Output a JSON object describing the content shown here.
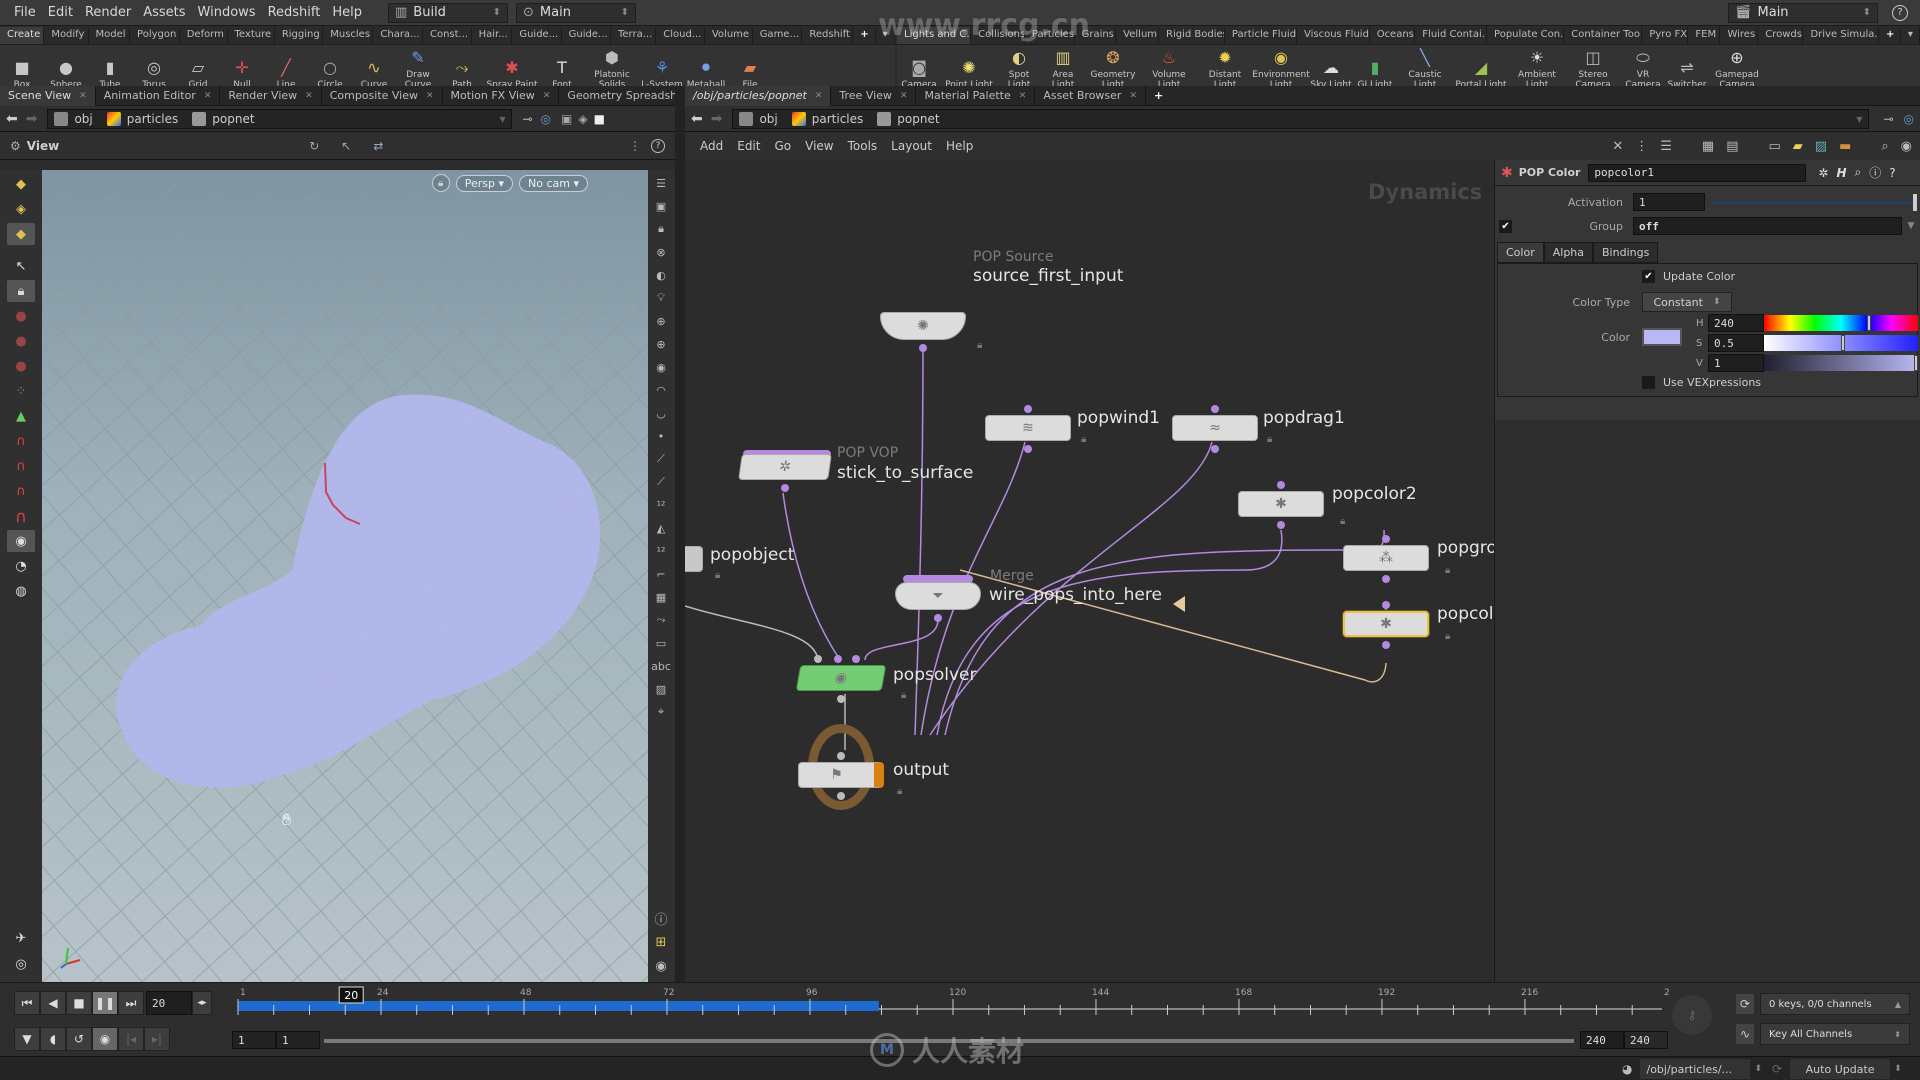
{
  "menubar": {
    "items": [
      "File",
      "Edit",
      "Render",
      "Assets",
      "Windows",
      "Redshift",
      "Help"
    ],
    "desktop": "Build",
    "desktop_icon": "layout-icon",
    "context": "Main",
    "context_icon": "target-icon",
    "right_context": "Main",
    "help_icon": "help-icon"
  },
  "shelf_left": {
    "tabs": [
      "Create",
      "Modify",
      "Model",
      "Polygon",
      "Deform",
      "Texture",
      "Rigging",
      "Muscles",
      "Chara...",
      "Const...",
      "Hair...",
      "Guide...",
      "Guide...",
      "Terra...",
      "Cloud...",
      "Volume",
      "Game...",
      "Redshift"
    ],
    "active_tab": "Create",
    "tools": [
      {
        "label": "Box",
        "icon": "box-icon",
        "glyph": "■",
        "color": "#c8c8c8"
      },
      {
        "label": "Sphere",
        "icon": "sphere-icon",
        "glyph": "●",
        "color": "#c8c8c8"
      },
      {
        "label": "Tube",
        "icon": "tube-icon",
        "glyph": "▮",
        "color": "#c8c8c8"
      },
      {
        "label": "Torus",
        "icon": "torus-icon",
        "glyph": "◎",
        "color": "#c8c8c8"
      },
      {
        "label": "Grid",
        "icon": "grid-icon",
        "glyph": "▱",
        "color": "#c8c8c8"
      },
      {
        "label": "Null",
        "icon": "null-icon",
        "glyph": "✛",
        "color": "#e05050"
      },
      {
        "label": "Line",
        "icon": "line-icon",
        "glyph": "╱",
        "color": "#d07070"
      },
      {
        "label": "Circle",
        "icon": "circle-icon",
        "glyph": "○",
        "color": "#aaa"
      },
      {
        "label": "Curve",
        "icon": "curve-icon",
        "glyph": "∿",
        "color": "#e0c050"
      },
      {
        "label": "Draw Curve",
        "icon": "draw-curve-icon",
        "glyph": "✎",
        "color": "#6a9ae0"
      },
      {
        "label": "Path",
        "icon": "path-icon",
        "glyph": "⤳",
        "color": "#e0c050"
      },
      {
        "label": "Spray Paint",
        "icon": "spray-paint-icon",
        "glyph": "✱",
        "color": "#e05050"
      },
      {
        "label": "Font",
        "icon": "font-icon",
        "glyph": "T",
        "color": "#ddd"
      },
      {
        "label": "Platonic Solids",
        "icon": "platonic-icon",
        "glyph": "⬢",
        "color": "#bbb"
      },
      {
        "label": "L-System",
        "icon": "lsystem-icon",
        "glyph": "⚘",
        "color": "#5a8ae0"
      },
      {
        "label": "Metaball",
        "icon": "metaball-icon",
        "glyph": "⚫",
        "color": "#7aa0e0"
      },
      {
        "label": "File",
        "icon": "file-icon",
        "glyph": "▰",
        "color": "#e08050"
      }
    ]
  },
  "shelf_right": {
    "tabs": [
      "Lights and C...",
      "Collisions",
      "Particles",
      "Grains",
      "Vellum",
      "Rigid Bodies",
      "Particle Fluids",
      "Viscous Fluids",
      "Oceans",
      "Fluid Contai...",
      "Populate Con...",
      "Container Tools",
      "Pyro FX",
      "FEM",
      "Wires",
      "Crowds",
      "Drive Simula..."
    ],
    "active_tab": "Lights and C...",
    "tools": [
      {
        "label": "Camera",
        "icon": "camera-icon",
        "glyph": "◙",
        "color": "#aaa"
      },
      {
        "label": "Point Light",
        "icon": "point-light-icon",
        "glyph": "✺",
        "color": "#f0e070"
      },
      {
        "label": "Spot Light",
        "icon": "spot-light-icon",
        "glyph": "◐",
        "color": "#e0d080"
      },
      {
        "label": "Area Light",
        "icon": "area-light-icon",
        "glyph": "▥",
        "color": "#e0d080"
      },
      {
        "label": "Geometry Light",
        "icon": "geometry-light-icon",
        "glyph": "❂",
        "color": "#e0a060"
      },
      {
        "label": "Volume Light",
        "icon": "volume-light-icon",
        "glyph": "♨",
        "color": "#e06030"
      },
      {
        "label": "Distant Light",
        "icon": "distant-light-icon",
        "glyph": "✹",
        "color": "#f0d050"
      },
      {
        "label": "Environment Light",
        "icon": "environment-light-icon",
        "glyph": "◉",
        "color": "#e0c050"
      },
      {
        "label": "Sky Light",
        "icon": "sky-light-icon",
        "glyph": "☁",
        "color": "#ddd"
      },
      {
        "label": "GI Light",
        "icon": "gi-light-icon",
        "glyph": "▮",
        "color": "#50b060"
      },
      {
        "label": "Caustic Light",
        "icon": "caustic-light-icon",
        "glyph": "╲",
        "color": "#8ab0e0"
      },
      {
        "label": "Portal Light",
        "icon": "portal-light-icon",
        "glyph": "◢",
        "color": "#a0c050"
      },
      {
        "label": "Ambient Light",
        "icon": "ambient-light-icon",
        "glyph": "☀",
        "color": "#ddd"
      },
      {
        "label": "Stereo Camera",
        "icon": "stereo-camera-icon",
        "glyph": "◫",
        "color": "#bbb"
      },
      {
        "label": "VR Camera",
        "icon": "vr-camera-icon",
        "glyph": "⬭",
        "color": "#bbb"
      },
      {
        "label": "Switcher",
        "icon": "switcher-icon",
        "glyph": "⇌",
        "color": "#bbb"
      },
      {
        "label": "Gamepad Camera",
        "icon": "gamepad-camera-icon",
        "glyph": "⊕",
        "color": "#ddd"
      }
    ]
  },
  "left_pane": {
    "tabs": [
      "Scene View",
      "Animation Editor",
      "Render View",
      "Composite View",
      "Motion FX View",
      "Geometry Spreadsh..."
    ],
    "active_tab": "Scene View",
    "path": [
      "obj",
      "particles",
      "popnet"
    ],
    "view_label": "View",
    "persp_button": "Persp",
    "cam_button": "No cam"
  },
  "right_pane": {
    "tabs": [
      "/obj/particles/popnet",
      "Tree View",
      "Material Palette",
      "Asset Browser"
    ],
    "active_tab": "/obj/particles/popnet",
    "path": [
      "obj",
      "particles",
      "popnet"
    ],
    "menu": [
      "Add",
      "Edit",
      "Go",
      "View",
      "Tools",
      "Layout",
      "Help"
    ],
    "context_watermark": "Dynamics"
  },
  "network": {
    "nodes": [
      {
        "name": "source_first_input",
        "type": "POP Source"
      },
      {
        "name": "popwind1",
        "type": ""
      },
      {
        "name": "popdrag1",
        "type": ""
      },
      {
        "name": "stick_to_surface",
        "type": "POP VOP"
      },
      {
        "name": "popcolor2",
        "type": ""
      },
      {
        "name": "popobject",
        "type": ""
      },
      {
        "name": "wire_pops_into_here",
        "type": "Merge"
      },
      {
        "name": "popgro",
        "type": ""
      },
      {
        "name": "popcol",
        "type": ""
      },
      {
        "name": "popsolver",
        "type": ""
      },
      {
        "name": "output",
        "type": ""
      }
    ],
    "colors": {
      "wire": "#b48ae0",
      "selected": "#e8c24a",
      "solver": "#74cc74",
      "feedback_wire": "#d8b890"
    }
  },
  "params": {
    "node_type": "POP Color",
    "node_name": "popcolor1",
    "activation_label": "Activation",
    "activation_value": "1",
    "group_label": "Group",
    "group_value": "off",
    "group_enabled": true,
    "tabs": [
      "Color",
      "Alpha",
      "Bindings"
    ],
    "active_tab": "Color",
    "update_color_label": "Update Color",
    "update_color_checked": true,
    "color_type_label": "Color Type",
    "color_type_value": "Constant",
    "color_label": "Color",
    "color_swatch": "#b8b8f4",
    "h_label": "H",
    "h_value": "240",
    "s_label": "S",
    "s_value": "0.5",
    "v_label": "V",
    "v_value": "1",
    "use_vex_label": "Use VEXpressions",
    "use_vex_checked": false
  },
  "timeline": {
    "current_frame": "20",
    "frame_field": "20",
    "ticks": [
      "1",
      "24",
      "48",
      "72",
      "96",
      "120",
      "144",
      "168",
      "192",
      "216",
      "2"
    ],
    "start": "1",
    "start2": "1",
    "end": "240",
    "end2": "240",
    "cached_fraction": 0.45,
    "keys_status": "0 keys, 0/0 channels",
    "key_all": "Key All Channels"
  },
  "statusbar": {
    "path": "/obj/particles/...",
    "update_mode": "Auto Update"
  },
  "watermark": {
    "top": "www.rrcg.cn",
    "bottom": "人人素材"
  }
}
